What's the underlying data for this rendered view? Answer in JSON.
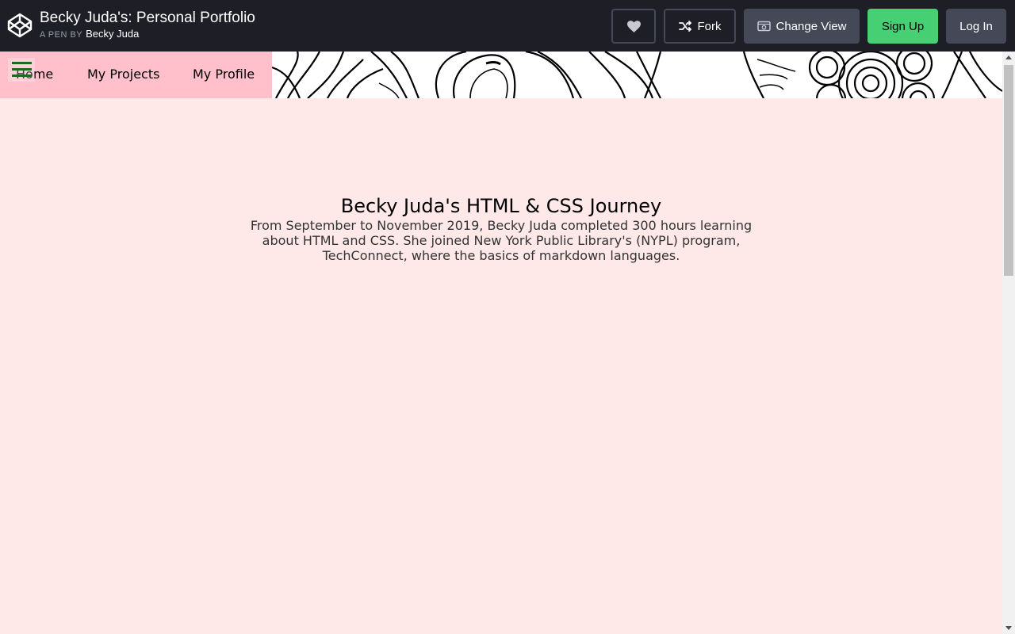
{
  "header": {
    "pen_title": "Becky Juda's: Personal Portfolio",
    "pen_by_prefix": "A PEN BY",
    "author": "Becky Juda",
    "buttons": {
      "like_icon": "heart-icon",
      "fork_label": "Fork",
      "change_view_label": "Change View",
      "sign_up_label": "Sign Up",
      "log_in_label": "Log In"
    },
    "colors": {
      "bar": "#1e1f26",
      "button": "#444857",
      "signup": "#47cf73"
    }
  },
  "nav": {
    "items": [
      {
        "label": "Home"
      },
      {
        "label": "My Projects"
      },
      {
        "label": "My Profile"
      }
    ],
    "background": "#ffc0cb"
  },
  "hero": {
    "title": "Becky Juda's HTML & CSS Journey",
    "text": "From September to November 2019, Becky Juda completed 300 hours learning about HTML and CSS. She joined New York Public Library's (NYPL) program, TechConnect, where the basics of markdown languages."
  },
  "page_background": "#ffe8e8"
}
